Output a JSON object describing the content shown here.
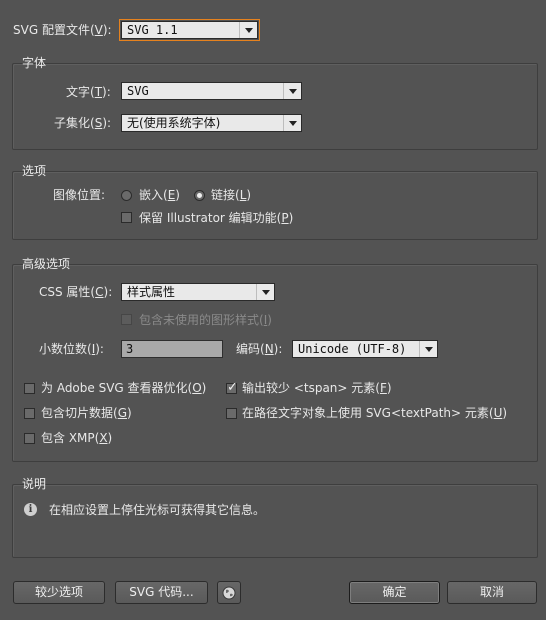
{
  "profile": {
    "label": "SVG 配置文件(",
    "key": "V",
    "suffix": "):",
    "value": "SVG 1.1"
  },
  "font_group": {
    "title": "字体",
    "type_label": "文字(",
    "type_key": "T",
    "type_suffix": "):",
    "type_value": "SVG",
    "subset_label": "子集化(",
    "subset_key": "S",
    "subset_suffix": "):",
    "subset_value": "无(使用系统字体)"
  },
  "options_group": {
    "title": "选项",
    "image_location_label": "图像位置:",
    "embed_label": "嵌入(",
    "embed_key": "E",
    "embed_suffix": ")",
    "link_label": "链接(",
    "link_key": "L",
    "link_suffix": ")",
    "preserve_label": "保留 Illustrator 编辑功能(",
    "preserve_key": "P",
    "preserve_suffix": ")"
  },
  "advanced_group": {
    "title": "高级选项",
    "css_label": "CSS 属性(",
    "css_key": "C",
    "css_suffix": "):",
    "css_value": "样式属性",
    "include_unused_label": "包含未使用的图形样式(",
    "include_unused_key": "I",
    "include_unused_suffix": ")",
    "decimal_label": "小数位数(",
    "decimal_key": "I",
    "decimal_suffix": "):",
    "decimal_value": "3",
    "encoding_label": "编码(",
    "encoding_key": "N",
    "encoding_suffix": "):",
    "encoding_value": "Unicode (UTF-8)",
    "optimize_label": "为 Adobe SVG 查看器优化(",
    "optimize_key": "O",
    "optimize_suffix": ")",
    "tspan_label": "输出较少 <tspan> 元素(",
    "tspan_key": "F",
    "tspan_suffix": ")",
    "slice_label": "包含切片数据(",
    "slice_key": "G",
    "slice_suffix": ")",
    "textpath_label": "在路径文字对象上使用 SVG<textPath> 元素(",
    "textpath_key": "U",
    "textpath_suffix": ")",
    "xmp_label": "包含 XMP(",
    "xmp_key": "X",
    "xmp_suffix": ")"
  },
  "description_group": {
    "title": "说明",
    "text": "在相应设置上停住光标可获得其它信息。"
  },
  "buttons": {
    "fewer_options": "较少选项",
    "svg_code": "SVG 代码...",
    "ok": "确定",
    "cancel": "取消"
  }
}
